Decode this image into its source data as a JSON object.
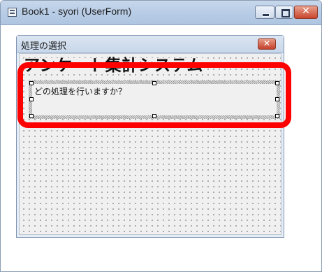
{
  "window": {
    "title": "Book1 - syori (UserForm)",
    "icon": "userform-window-icon",
    "buttons": {
      "minimize": "minimize-icon",
      "maximize": "maximize-icon",
      "close": "close-icon"
    }
  },
  "userform": {
    "caption": "処理の選択",
    "close_glyph": "✕",
    "title_label": "アンケート集計システム",
    "question_label": "どの処理を行いますか？",
    "grid": "dotted",
    "selected_control": "question_label"
  },
  "highlight": {
    "color": "#ff0000",
    "target": "selected label control"
  },
  "colors": {
    "titlebar": "#b9cde6",
    "form_background": "#f0f0f0",
    "close_button": "#c9452c"
  }
}
